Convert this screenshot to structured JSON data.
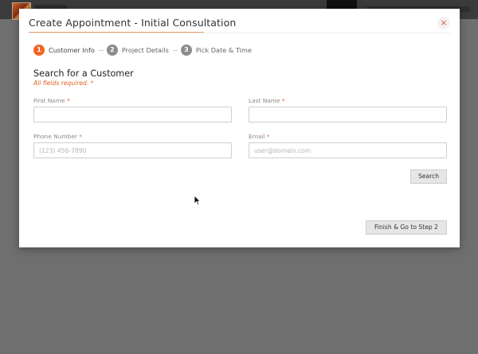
{
  "modal": {
    "title": "Create Appointment - Initial Consultation",
    "close_label": "×"
  },
  "steps": [
    {
      "number": "1",
      "label": "Customer Info",
      "active": true
    },
    {
      "number": "2",
      "label": "Project Details",
      "active": false
    },
    {
      "number": "3",
      "label": "Pick Date & Time",
      "active": false
    }
  ],
  "section": {
    "title": "Search for a Customer",
    "subtitle": "All fields required.",
    "required_marker": "*"
  },
  "fields": {
    "first_name": {
      "label": "First Name",
      "value": "",
      "placeholder": ""
    },
    "last_name": {
      "label": "Last Name",
      "value": "",
      "placeholder": ""
    },
    "phone": {
      "label": "Phone Number",
      "value": "",
      "placeholder": "(123) 456-7890"
    },
    "email": {
      "label": "Email",
      "value": "",
      "placeholder": "user@domain.com"
    }
  },
  "buttons": {
    "search": "Search",
    "finish": "Finish & Go to Step 2"
  },
  "colors": {
    "accent": "#f26522",
    "overlay": "#6f6f6f",
    "step_inactive": "#8c8c8c"
  }
}
